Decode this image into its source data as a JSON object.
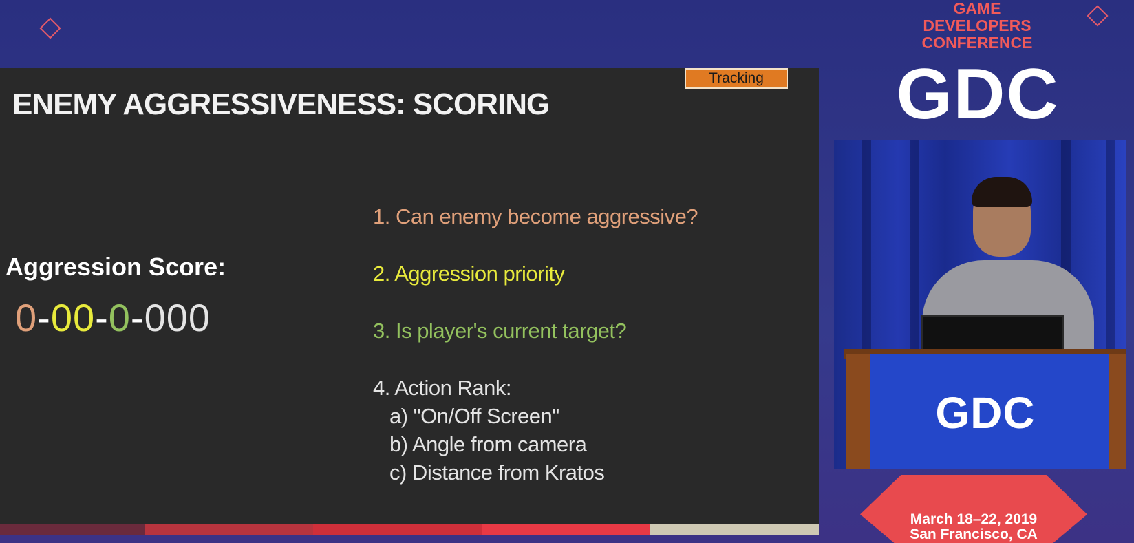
{
  "slide": {
    "title": "ENEMY AGGRESSIVENESS: SCORING",
    "tag": "Tracking",
    "score_label": "Aggression Score:",
    "score_parts": {
      "p1": "0",
      "d1": "-",
      "p2": "00",
      "d2": "-",
      "p3": "0",
      "d3": "-",
      "p4": "000"
    },
    "list": [
      {
        "text": "1.  Can enemy become aggressive?",
        "color": "#e0a07a"
      },
      {
        "text": "2. Aggression priority",
        "color": "#e8ea3c"
      },
      {
        "text": "3. Is player's current target?",
        "color": "#93c15e"
      },
      {
        "text": "4. Action Rank:",
        "color": "#e4e4e4"
      }
    ],
    "sublist": [
      "a) \"On/Off Screen\"",
      "b) Angle from camera",
      "c) Distance from Kratos"
    ],
    "score_colors": {
      "p1": "#e0a07a",
      "p2": "#e8ea3c",
      "p3": "#93c15e",
      "p4": "#e4e4e4"
    }
  },
  "conference": {
    "line1": "GAME",
    "line2": "DEVELOPERS",
    "line3": "CONFERENCE",
    "logo": "GDC",
    "podium_logo": "GDC",
    "date": "March 18–22, 2019",
    "location": "San Francisco, CA"
  }
}
